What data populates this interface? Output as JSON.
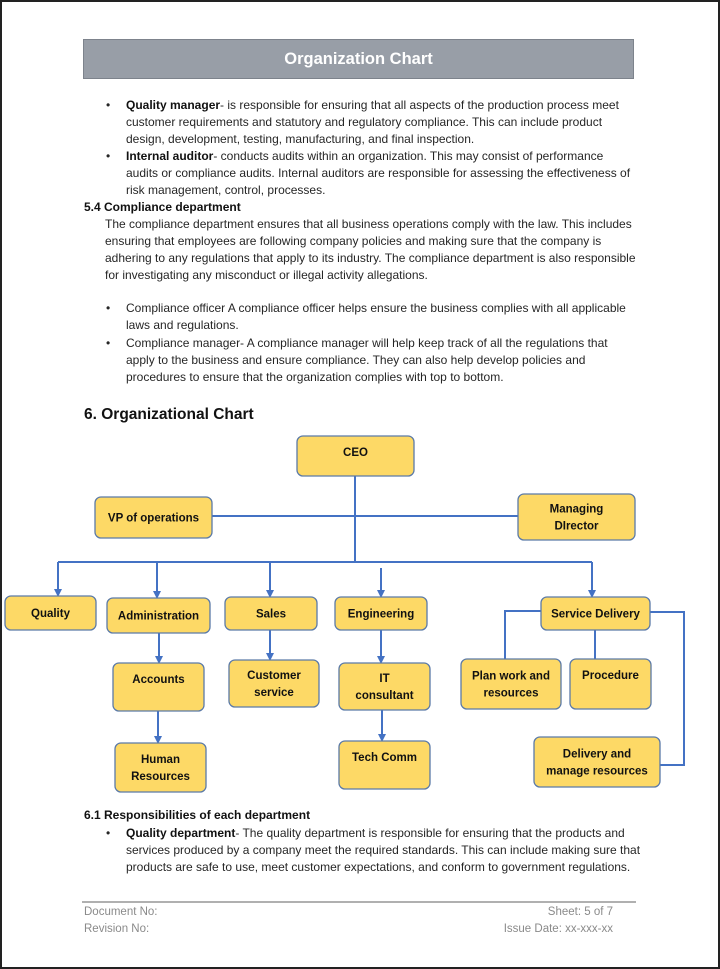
{
  "header": {
    "title": "Organization Chart"
  },
  "section5_3_bullets": [
    {
      "term": "Quality manager",
      "text": "- is responsible for ensuring that all aspects of the production process meet customer requirements and statutory and regulatory compliance. This can include product design, development, testing, manufacturing, and final inspection."
    },
    {
      "term": "Internal auditor",
      "text": "- conducts audits within an organization. This may consist of performance audits or compliance audits. Internal auditors are responsible for assessing the effectiveness of risk management, control, processes."
    }
  ],
  "section5_4": {
    "heading": "5.4 Compliance department",
    "paragraph": "The compliance department ensures that all business operations comply with the law. This includes ensuring that employees are following company policies and making sure that the company is adhering to any regulations that apply to its industry. The compliance department is also responsible for investigating any misconduct or illegal activity allegations.",
    "bullets": [
      "Compliance officer A compliance officer helps ensure the business complies with all applicable laws and regulations.",
      "Compliance manager- A compliance manager will help keep track of all the regulations that apply to the business and ensure compliance. They can also help develop policies and procedures to ensure that the organization complies with top to bottom."
    ]
  },
  "section6": {
    "heading": "6.  Organizational Chart",
    "org_chart": {
      "colors": {
        "box_fill": "#fdd966",
        "box_stroke": "#5b7aa8",
        "connector": "#4472c4"
      },
      "nodes": {
        "ceo": [
          "CEO"
        ],
        "vp": [
          "VP of operations"
        ],
        "md": [
          "Managing",
          "DIrector"
        ],
        "quality": [
          "Quality"
        ],
        "admin": [
          "Administration"
        ],
        "sales": [
          "Sales"
        ],
        "eng": [
          "Engineering"
        ],
        "sd": [
          "Service Delivery"
        ],
        "accounts": [
          "Accounts"
        ],
        "hr": [
          "Human",
          "Resources"
        ],
        "cs": [
          "Customer",
          "service"
        ],
        "it": [
          "IT",
          "consultant"
        ],
        "tc": [
          "Tech Comm"
        ],
        "plan": [
          "Plan work and",
          "resources"
        ],
        "proc": [
          "Procedure"
        ],
        "deliv": [
          "Delivery and",
          "manage resources"
        ]
      },
      "edges": [
        [
          "ceo",
          "vp"
        ],
        [
          "ceo",
          "md"
        ],
        [
          "ceo",
          "quality"
        ],
        [
          "ceo",
          "admin"
        ],
        [
          "ceo",
          "sales"
        ],
        [
          "ceo",
          "eng"
        ],
        [
          "ceo",
          "sd"
        ],
        [
          "admin",
          "accounts"
        ],
        [
          "accounts",
          "hr"
        ],
        [
          "sales",
          "cs"
        ],
        [
          "eng",
          "it"
        ],
        [
          "it",
          "tc"
        ],
        [
          "sd",
          "plan"
        ],
        [
          "sd",
          "proc"
        ],
        [
          "sd",
          "deliv"
        ]
      ]
    }
  },
  "section6_1": {
    "heading": "6.1  Responsibilities of each department",
    "bullets": [
      {
        "term": "Quality department",
        "text": "- The quality department is responsible for ensuring that the products and services produced by a company meet the required standards. This can include making sure that products are safe to use, meet customer expectations, and conform to government regulations."
      }
    ]
  },
  "footer": {
    "document_no": "Document No:",
    "revision_no": "Revision No:",
    "sheet": "Sheet: 5 of 7",
    "issue_date": "Issue Date: xx-xxx-xx"
  }
}
